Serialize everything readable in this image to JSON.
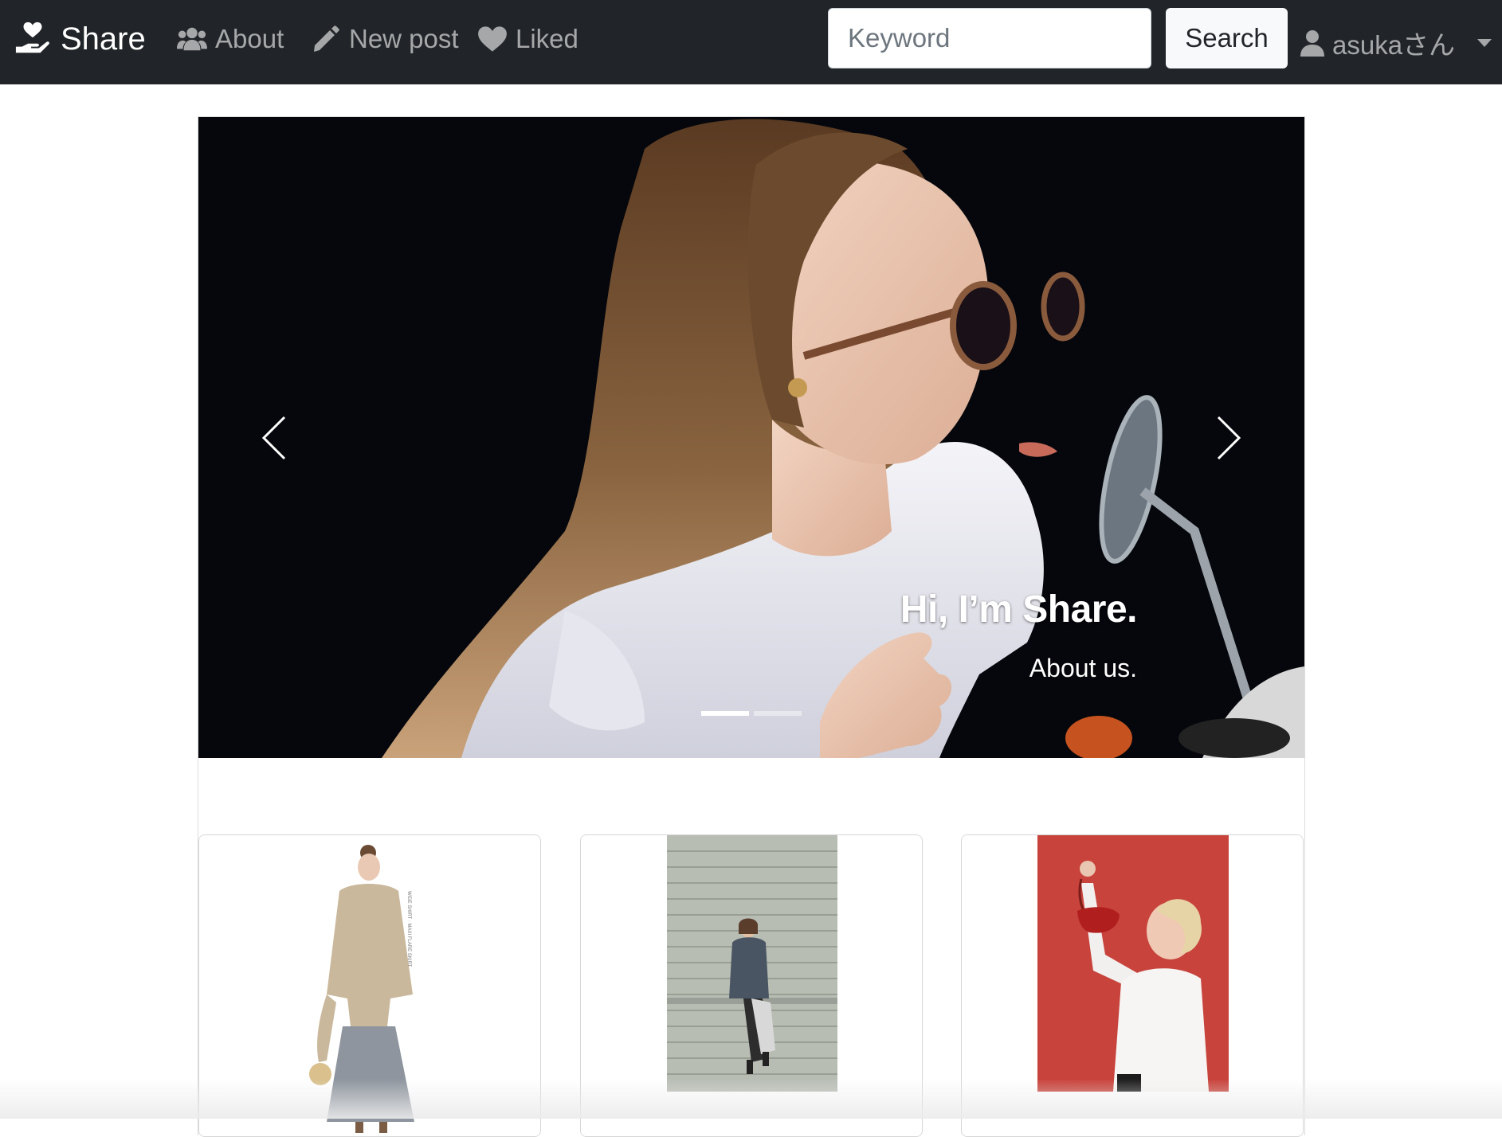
{
  "navbar": {
    "brand": "Share",
    "links": [
      {
        "label": "About",
        "icon": "users-icon"
      },
      {
        "label": "New post",
        "icon": "pencil-icon"
      },
      {
        "label": "Liked",
        "icon": "heart-icon"
      }
    ],
    "search": {
      "placeholder": "Keyword",
      "value": "",
      "button_label": "Search"
    },
    "user": {
      "label": "asukaさん",
      "icon": "user-icon"
    }
  },
  "carousel": {
    "title": "Hi, I’m Share.",
    "subtitle": "About us.",
    "slide_count": 2,
    "active_index": 0,
    "prev_icon": "chevron-left-icon",
    "next_icon": "chevron-right-icon"
  },
  "posts": [
    {
      "image": "fashion-model-beige-shirt-grey-skirt"
    },
    {
      "image": "woman-sitting-on-brick-wall"
    },
    {
      "image": "woman-holding-red-bag-red-background"
    }
  ],
  "colors": {
    "navbar_bg": "#212529",
    "nav_text": "rgba(255,255,255,0.6)",
    "accent_red": "#c8433c"
  }
}
